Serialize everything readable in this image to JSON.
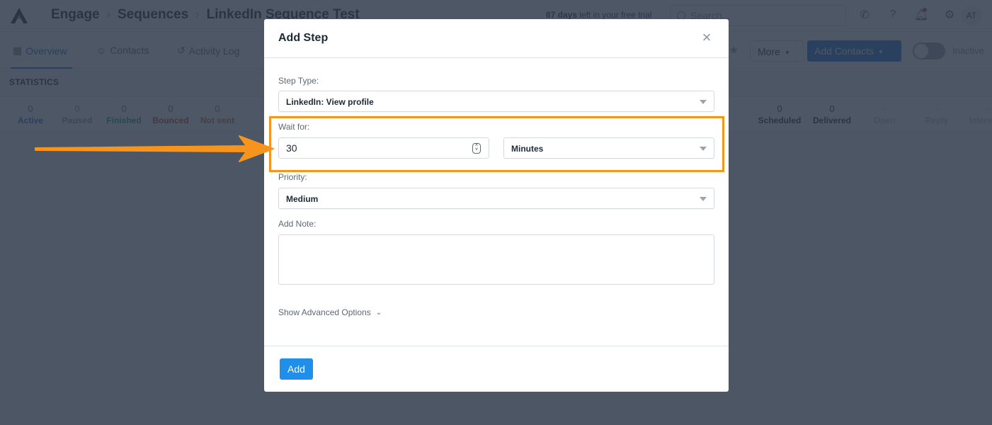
{
  "header": {
    "breadcrumb": [
      "Engage",
      "Sequences",
      "LinkedIn Sequence Test"
    ],
    "trial": {
      "days": "87 days",
      "suffix": " left in your free trial"
    },
    "search_placeholder": "Search...",
    "icons": [
      "phone-icon",
      "help-icon",
      "bell-icon",
      "gear-icon"
    ],
    "avatar_initials": "AT"
  },
  "tabs": [
    {
      "label": "Overview",
      "icon": "grid-icon",
      "active": true
    },
    {
      "label": "Contacts",
      "icon": "users-icon",
      "active": false
    },
    {
      "label": "Activity Log",
      "icon": "history-icon",
      "active": false
    }
  ],
  "toolbar": {
    "more_label": "More",
    "add_contacts_label": "Add Contacts",
    "status_label": "Inactive"
  },
  "statistics": {
    "title": "STATISTICS",
    "left": [
      {
        "value": "0",
        "label": "Active",
        "color": "#1e6fd0"
      },
      {
        "value": "0",
        "label": "Paused",
        "color": "#8a94a0"
      },
      {
        "value": "0",
        "label": "Finished",
        "color": "#1a9c7a"
      },
      {
        "value": "0",
        "label": "Bounced",
        "color": "#c0392b"
      },
      {
        "value": "0",
        "label": "Not sent",
        "color": "#c0693b"
      }
    ],
    "right": [
      {
        "value": "0",
        "label": "Scheduled",
        "color": "#1f2a37"
      },
      {
        "value": "0",
        "label": "Delivered",
        "color": "#1f2a37"
      },
      {
        "value": "-",
        "label": "Open",
        "color": "#c3c9d0"
      },
      {
        "value": "-",
        "label": "Reply",
        "color": "#c3c9d0"
      },
      {
        "value": "-",
        "label": "Interested",
        "color": "#c3c9d0"
      }
    ]
  },
  "modal": {
    "title": "Add Step",
    "step_type": {
      "label": "Step Type:",
      "value": "LinkedIn: View profile"
    },
    "wait_for": {
      "label": "Wait for:",
      "amount": "30",
      "unit": "Minutes"
    },
    "priority": {
      "label": "Priority:",
      "value": "Medium"
    },
    "note": {
      "label": "Add Note:",
      "value": ""
    },
    "advanced_label": "Show Advanced Options",
    "add_label": "Add"
  },
  "annotation": {
    "color": "#f7941d",
    "target": "wait-for-field"
  }
}
